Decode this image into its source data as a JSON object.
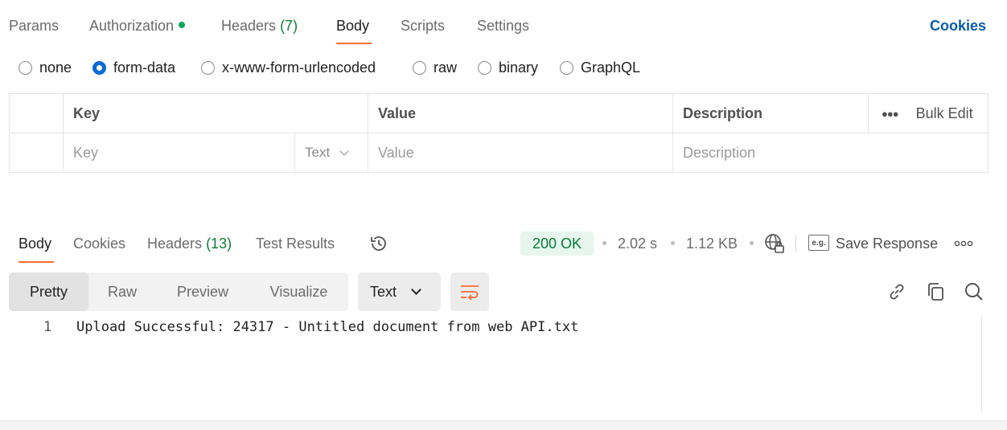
{
  "request_tabs": [
    {
      "label": "Params"
    },
    {
      "label": "Authorization"
    },
    {
      "label": "Headers",
      "count": "(7)"
    },
    {
      "label": "Body"
    },
    {
      "label": "Scripts"
    },
    {
      "label": "Settings"
    }
  ],
  "active_request_tab": "Body",
  "cookies_label": "Cookies",
  "body_modes": [
    "none",
    "form-data",
    "x-www-form-urlencoded",
    "raw",
    "binary",
    "GraphQL"
  ],
  "selected_body_mode": "form-data",
  "form_table": {
    "headers": {
      "key": "Key",
      "value": "Value",
      "description": "Description"
    },
    "bulk_edit": "Bulk Edit",
    "placeholders": {
      "key": "Key",
      "type": "Text",
      "value": "Value",
      "description": "Description"
    }
  },
  "response_tabs": [
    {
      "label": "Body"
    },
    {
      "label": "Cookies"
    },
    {
      "label": "Headers",
      "count": "(13)"
    },
    {
      "label": "Test Results"
    }
  ],
  "active_response_tab": "Body",
  "response_meta": {
    "status": "200 OK",
    "time": "2.02 s",
    "size": "1.12 KB",
    "save_label": "Save Response",
    "eg_label": "e.g."
  },
  "view_modes": [
    "Pretty",
    "Raw",
    "Preview",
    "Visualize"
  ],
  "active_view_mode": "Pretty",
  "format": "Text",
  "code_lines": [
    {
      "no": "1",
      "text": "Upload Successful: 24317 - Untitled document from web API.txt"
    }
  ],
  "colors": {
    "accent": "#ff6c37",
    "link": "#0b5cad",
    "radio_selected": "#0b69d3",
    "status_ok_bg": "#e6f6ec",
    "status_ok_text": "#0a7a3c",
    "auth_dot": "#0fa958"
  },
  "icons": [
    "history-icon",
    "globe-lock-icon",
    "example-icon",
    "more-icon",
    "word-wrap-icon",
    "link-icon",
    "copy-icon",
    "search-icon"
  ]
}
